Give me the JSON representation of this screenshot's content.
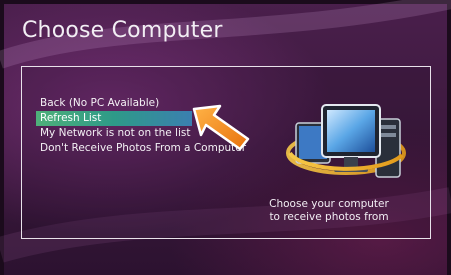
{
  "screen": {
    "title": "Choose Computer"
  },
  "menu": {
    "items": [
      {
        "label": "Back (No PC Available)",
        "selected": false
      },
      {
        "label": "Refresh List",
        "selected": true
      },
      {
        "label": "My Network is not on the list",
        "selected": false
      },
      {
        "label": "Don't Receive Photos From a Computer",
        "selected": false
      }
    ]
  },
  "caption": {
    "line1": "Choose your computer",
    "line2": "to receive photos from"
  },
  "icons": {
    "pointer": "arrow-pointer-icon",
    "computer": "computer-monitor-icon"
  },
  "colors": {
    "background": "#3e1a3f",
    "selection_start": "#4fb07a",
    "selection_end": "#3b7fb0",
    "arrow": "#f08a1c",
    "text": "#f4f1f5"
  }
}
